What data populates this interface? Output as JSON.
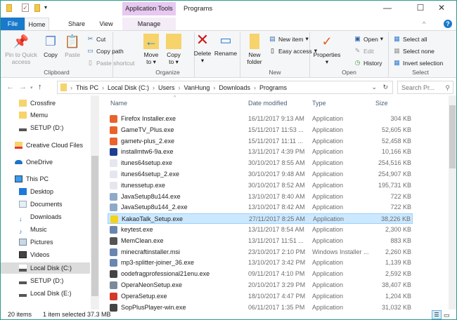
{
  "window": {
    "title": "Programs",
    "context_tab": "Application Tools"
  },
  "tabs": [
    "File",
    "Home",
    "Share",
    "View",
    "Manage"
  ],
  "ribbon": {
    "clipboard": {
      "label": "Clipboard",
      "pin": "Pin to Quick access",
      "copy": "Copy",
      "paste": "Paste",
      "cut": "Cut",
      "copy_path": "Copy path",
      "paste_shortcut": "Paste shortcut"
    },
    "organize": {
      "label": "Organize",
      "move_to": "Move to",
      "copy_to": "Copy to",
      "delete": "Delete",
      "rename": "Rename"
    },
    "new": {
      "label": "New",
      "new_folder": "New folder",
      "new_item": "New item",
      "easy_access": "Easy access"
    },
    "open": {
      "label": "Open",
      "properties": "Properties",
      "open": "Open",
      "edit": "Edit",
      "history": "History"
    },
    "select": {
      "label": "Select",
      "select_all": "Select all",
      "select_none": "Select none",
      "invert": "Invert selection"
    }
  },
  "address": {
    "path": [
      "This PC",
      "Local Disk (C:)",
      "Users",
      "VanHung",
      "Downloads",
      "Programs"
    ],
    "search_placeholder": "Search Pr..."
  },
  "sidebar": [
    {
      "label": "Crossfire",
      "icon": "folder"
    },
    {
      "label": "Memu",
      "icon": "folder"
    },
    {
      "label": "SETUP (D:)",
      "icon": "drive"
    },
    {
      "label": "Creative Cloud Files",
      "icon": "creative-cloud"
    },
    {
      "label": "OneDrive",
      "icon": "onedrive"
    },
    {
      "label": "This PC",
      "icon": "pc"
    },
    {
      "label": "Desktop",
      "icon": "desktop"
    },
    {
      "label": "Documents",
      "icon": "documents"
    },
    {
      "label": "Downloads",
      "icon": "downloads"
    },
    {
      "label": "Music",
      "icon": "music"
    },
    {
      "label": "Pictures",
      "icon": "pictures"
    },
    {
      "label": "Videos",
      "icon": "videos"
    },
    {
      "label": "Local Disk (C:)",
      "icon": "drive",
      "selected": true
    },
    {
      "label": "SETUP (D:)",
      "icon": "drive"
    },
    {
      "label": "Local Disk (E:)",
      "icon": "drive"
    }
  ],
  "columns": [
    "Name",
    "Date modified",
    "Type",
    "Size"
  ],
  "files": [
    {
      "name": "Firefox Installer.exe",
      "date": "16/11/2017 9:13 AM",
      "type": "Application",
      "size": "304 KB",
      "color": "#e8622c"
    },
    {
      "name": "GameTV_Plus.exe",
      "date": "15/11/2017 11:53 ...",
      "type": "Application",
      "size": "52,605 KB",
      "color": "#e9632b"
    },
    {
      "name": "gametv-plus_2.exe",
      "date": "15/11/2017 11:11 ...",
      "type": "Application",
      "size": "52,458 KB",
      "color": "#e9632b"
    },
    {
      "name": "installmtw6-9a.exe",
      "date": "13/11/2017 4:39 PM",
      "type": "Application",
      "size": "10,166 KB",
      "color": "#1c3f8f"
    },
    {
      "name": "itunes64setup.exe",
      "date": "30/10/2017 8:55 AM",
      "type": "Application",
      "size": "254,516 KB",
      "color": "#e6e6f0"
    },
    {
      "name": "itunes64setup_2.exe",
      "date": "30/10/2017 9:48 AM",
      "type": "Application",
      "size": "254,907 KB",
      "color": "#e6e6f0"
    },
    {
      "name": "itunessetup.exe",
      "date": "30/10/2017 8:52 AM",
      "type": "Application",
      "size": "195,731 KB",
      "color": "#e6e6f0"
    },
    {
      "name": "JavaSetup8u144.exe",
      "date": "13/10/2017 8:40 AM",
      "type": "Application",
      "size": "722 KB",
      "color": "#8fa9c8"
    },
    {
      "name": "JavaSetup8u144_2.exe",
      "date": "13/10/2017 8:42 AM",
      "type": "Application",
      "size": "722 KB",
      "color": "#8fa9c8"
    },
    {
      "name": "KakaoTalk_Setup.exe",
      "date": "27/11/2017 8:25 AM",
      "type": "Application",
      "size": "38,226 KB",
      "color": "#f7d11a",
      "selected": true
    },
    {
      "name": "keytest.exe",
      "date": "13/11/2017 8:54 AM",
      "type": "Application",
      "size": "2,300 KB",
      "color": "#6a86b0"
    },
    {
      "name": "MemClean.exe",
      "date": "13/11/2017 11:51 ...",
      "type": "Application",
      "size": "883 KB",
      "color": "#555555"
    },
    {
      "name": "minecraftinstaller.msi",
      "date": "23/10/2017 2:10 PM",
      "type": "Windows Installer ...",
      "size": "2,260 KB",
      "color": "#6a86b0"
    },
    {
      "name": "mp3-splitter-joiner_36.exe",
      "date": "13/10/2017 3:42 PM",
      "type": "Application",
      "size": "1,139 KB",
      "color": "#6a86b0"
    },
    {
      "name": "oodefragprofessional21enu.exe",
      "date": "09/11/2017 4:10 PM",
      "type": "Application",
      "size": "2,592 KB",
      "color": "#444444"
    },
    {
      "name": "OperaNeonSetup.exe",
      "date": "20/10/2017 3:29 PM",
      "type": "Application",
      "size": "38,407 KB",
      "color": "#7a8a9a"
    },
    {
      "name": "OperaSetup.exe",
      "date": "18/10/2017 4:47 PM",
      "type": "Application",
      "size": "1,204 KB",
      "color": "#d33a2c"
    },
    {
      "name": "SopPlusPlayer-win.exe",
      "date": "06/11/2017 1:35 PM",
      "type": "Application",
      "size": "31,032 KB",
      "color": "#444444"
    }
  ],
  "status": {
    "count": "20 items",
    "selected": "1 item selected",
    "size": "37.3 MB"
  }
}
